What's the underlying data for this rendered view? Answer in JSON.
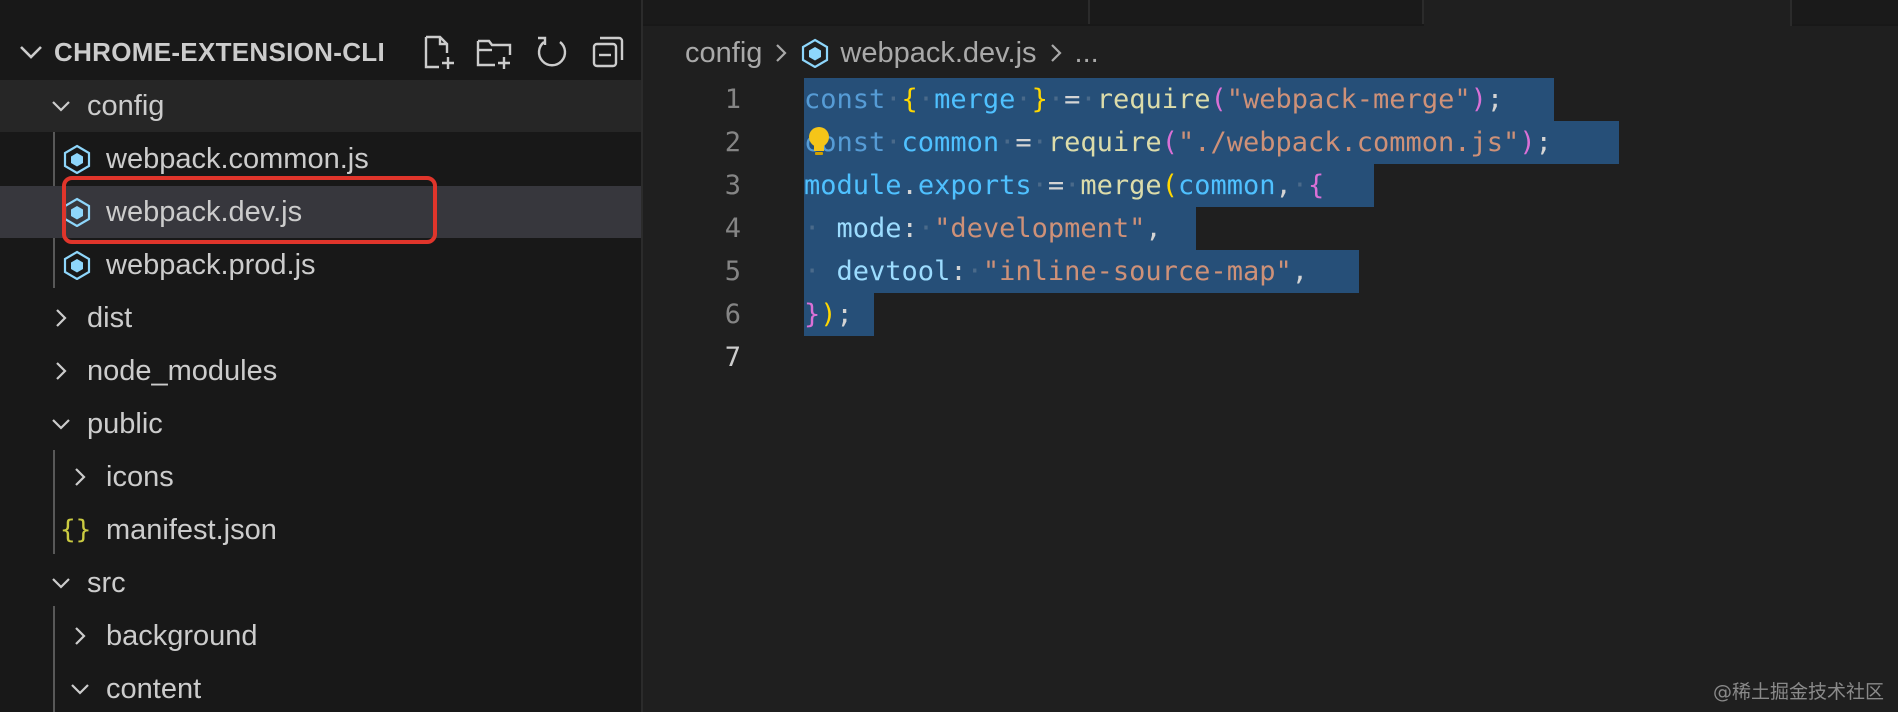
{
  "explorer": {
    "title": "CHROME-EXTENSION-CLI",
    "actions": [
      {
        "name": "new-file-icon"
      },
      {
        "name": "new-folder-icon"
      },
      {
        "name": "refresh-icon"
      },
      {
        "name": "collapse-all-icon"
      }
    ]
  },
  "tree": [
    {
      "label": "config",
      "type": "folder",
      "expanded": true,
      "depth": 0
    },
    {
      "label": "webpack.common.js",
      "type": "webpack-file",
      "depth": 1
    },
    {
      "label": "webpack.dev.js",
      "type": "webpack-file",
      "depth": 1,
      "selected": true
    },
    {
      "label": "webpack.prod.js",
      "type": "webpack-file",
      "depth": 1
    },
    {
      "label": "dist",
      "type": "folder",
      "expanded": false,
      "depth": 0
    },
    {
      "label": "node_modules",
      "type": "folder",
      "expanded": false,
      "depth": 0
    },
    {
      "label": "public",
      "type": "folder",
      "expanded": true,
      "depth": 0
    },
    {
      "label": "icons",
      "type": "folder",
      "expanded": false,
      "depth": 1
    },
    {
      "label": "manifest.json",
      "type": "json-file",
      "depth": 1
    },
    {
      "label": "src",
      "type": "folder",
      "expanded": true,
      "depth": 0
    },
    {
      "label": "background",
      "type": "folder",
      "expanded": false,
      "depth": 1
    },
    {
      "label": "content",
      "type": "folder",
      "expanded": true,
      "depth": 1
    }
  ],
  "breadcrumb": {
    "folder": "config",
    "file": "webpack.dev.js",
    "more": "..."
  },
  "editor": {
    "current_line": 7,
    "lines": [
      {
        "num": "1",
        "text": "const { merge } = require(\"webpack-merge\");"
      },
      {
        "num": "2",
        "text": "const common = require(\"./webpack.common.js\");"
      },
      {
        "num": "3",
        "text": "module.exports = merge(common, {"
      },
      {
        "num": "4",
        "text": "  mode: \"development\","
      },
      {
        "num": "5",
        "text": "  devtool: \"inline-source-map\","
      },
      {
        "num": "6",
        "text": "});"
      },
      {
        "num": "7",
        "text": ""
      }
    ]
  },
  "watermark": "@稀土掘金技术社区",
  "colors": {
    "selection": "#264f78",
    "highlight_box": "#e0352b",
    "webpack_icon": "#8ed6fb",
    "json_icon": "#cbcb41"
  }
}
